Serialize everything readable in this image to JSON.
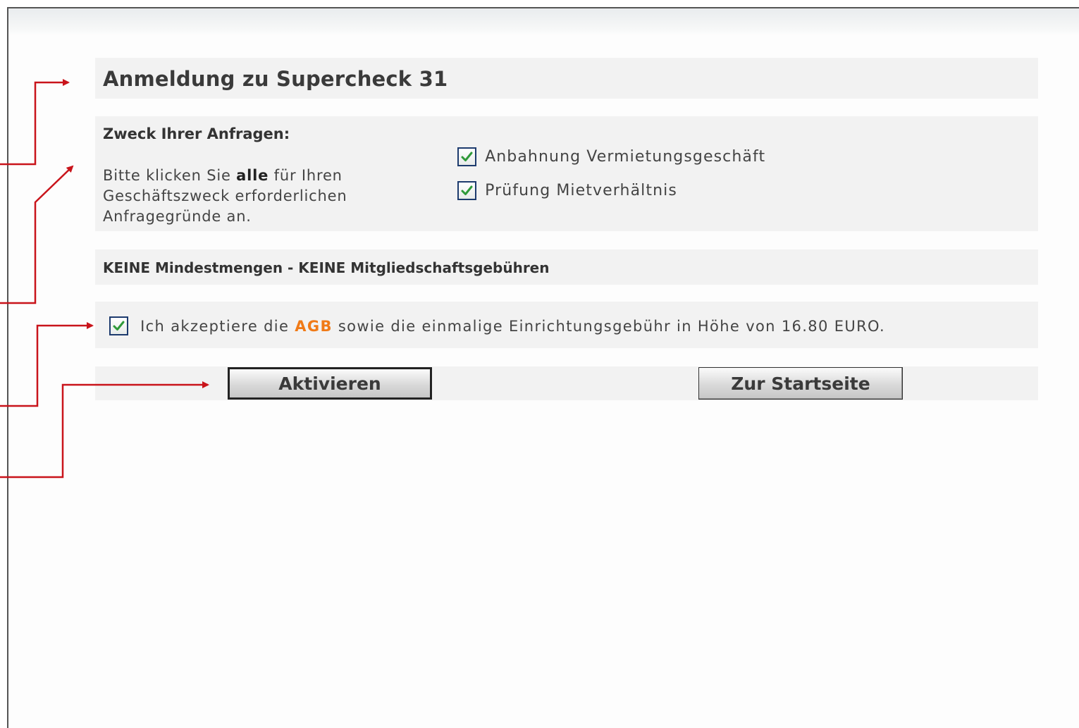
{
  "form": {
    "title": "Anmeldung zu Supercheck 31",
    "purpose": {
      "heading": "Zweck Ihrer Anfragen:",
      "instruction_before": "Bitte klicken Sie ",
      "instruction_bold": "alle",
      "instruction_after": " für Ihren Geschäftszweck erforderlichen Anfragegründe an.",
      "options": [
        {
          "label": "Anbahnung Vermietungsgeschäft",
          "checked": true
        },
        {
          "label": "Prüfung Mietverhältnis",
          "checked": true
        }
      ]
    },
    "notice": "KEINE Mindestmengen - KEINE Mitgliedschaftsgebühren",
    "accept": {
      "checked": true,
      "text_before": "Ich akzeptiere die ",
      "link": "AGB",
      "text_after": " sowie die einmalige Einrichtungsgebühr in Höhe von 16.80 EURO."
    },
    "buttons": {
      "activate": "Aktivieren",
      "home": "Zur Startseite"
    }
  },
  "colors": {
    "panel_bg": "#f2f2f2",
    "link": "#f07a17",
    "checkmark": "#2f9a3a",
    "annotation_arrow": "#c9141b"
  },
  "icons": {
    "checkbox_checked": "checkbox-checked-icon",
    "annotation_arrow": "red-arrow-icon"
  }
}
